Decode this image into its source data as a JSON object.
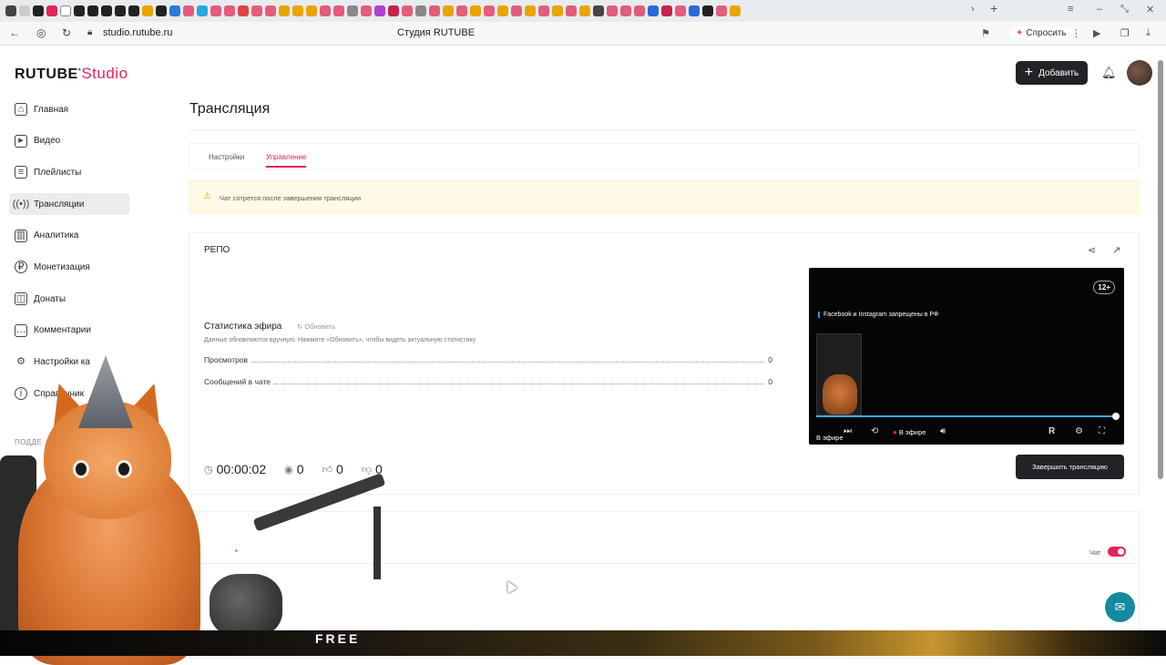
{
  "browser": {
    "url": "studio.rutube.ru",
    "page_title": "Студия RUTUBE",
    "ask_label": "Спросить"
  },
  "app": {
    "logo_main": "RUTUBE",
    "logo_studio": "Studio",
    "add_label": "Добавить"
  },
  "sidebar": {
    "items": [
      {
        "label": "Главная",
        "icon": "home-icon"
      },
      {
        "label": "Видео",
        "icon": "video-icon"
      },
      {
        "label": "Плейлисты",
        "icon": "playlist-icon"
      },
      {
        "label": "Трансляции",
        "icon": "broadcast-icon"
      },
      {
        "label": "Аналитика",
        "icon": "analytics-icon"
      },
      {
        "label": "Монетизация",
        "icon": "monetization-icon"
      },
      {
        "label": "Донаты",
        "icon": "donate-icon"
      },
      {
        "label": "Комментарии",
        "icon": "comments-icon"
      },
      {
        "label": "Настройки ка",
        "icon": "settings-icon"
      },
      {
        "label": "Справочник",
        "icon": "help-icon"
      }
    ],
    "section_label": "ПОДДЕ"
  },
  "main": {
    "title": "Трансляция",
    "tabs": [
      "Настройки",
      "Управление"
    ],
    "warning": "Чат сотрется после завершения трансляции",
    "stream_name": "РЕПО",
    "stats_title": "Статистика эфира",
    "refresh_label": "Обновить",
    "stats_note": "Данные обновляются вручную. Нажмите «Обновить», чтобы видеть актуальную статистику",
    "stats": [
      {
        "label": "Просмотров",
        "value": "0"
      },
      {
        "label": "Сообщений в чате",
        "value": "0"
      }
    ],
    "timer": "00:00:02",
    "viewers": "0",
    "likes": "0",
    "dislikes": "0",
    "end_button": "Завершить трансляцию",
    "chat_label": "Чат"
  },
  "player": {
    "age": "12+",
    "banner": "Facebook и Instagram запрещены в РФ",
    "live_label": "В эфире",
    "overlay_live": "В эфире"
  },
  "overlay_text": "FREE",
  "colors": {
    "accent": "#e4245a",
    "dark_button": "#222326",
    "help_button": "#148aa0",
    "warning_bg": "#fffbe6",
    "progress": "#3ca8e6"
  }
}
